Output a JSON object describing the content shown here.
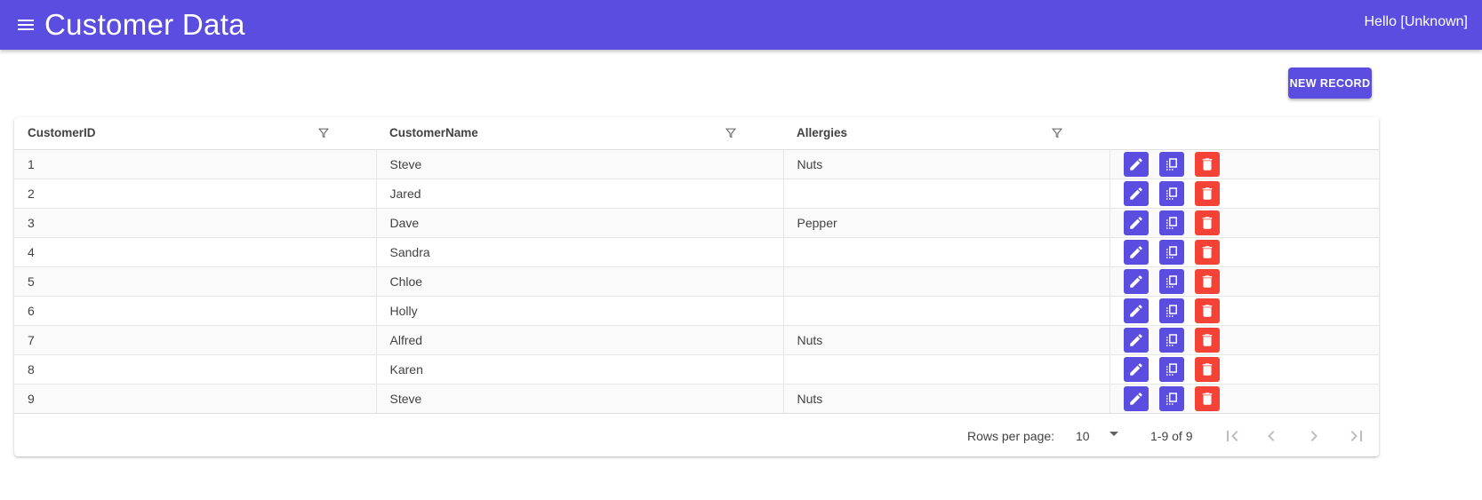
{
  "app": {
    "title": "Customer Data",
    "greeting": "Hello [Unknown]",
    "brand_color": "#5a4ddf"
  },
  "toolbar": {
    "new_record_label": "NEW RECORD"
  },
  "table": {
    "columns": [
      "CustomerID",
      "CustomerName",
      "Allergies"
    ],
    "rows": [
      {
        "id": "1",
        "name": "Steve",
        "allergies": "Nuts"
      },
      {
        "id": "2",
        "name": "Jared",
        "allergies": ""
      },
      {
        "id": "3",
        "name": "Dave",
        "allergies": "Pepper"
      },
      {
        "id": "4",
        "name": "Sandra",
        "allergies": ""
      },
      {
        "id": "5",
        "name": "Chloe",
        "allergies": ""
      },
      {
        "id": "6",
        "name": "Holly",
        "allergies": ""
      },
      {
        "id": "7",
        "name": "Alfred",
        "allergies": "Nuts"
      },
      {
        "id": "8",
        "name": "Karen",
        "allergies": ""
      },
      {
        "id": "9",
        "name": "Steve",
        "allergies": "Nuts"
      }
    ],
    "row_actions": [
      "edit-icon",
      "copy-icon",
      "delete-icon"
    ],
    "delete_color": "#f44336"
  },
  "pagination": {
    "rows_per_page_label": "Rows per page:",
    "rows_per_page_value": "10",
    "range_label": "1-9 of 9",
    "buttons": [
      "first-page-icon",
      "previous-page-icon",
      "next-page-icon",
      "last-page-icon"
    ]
  }
}
